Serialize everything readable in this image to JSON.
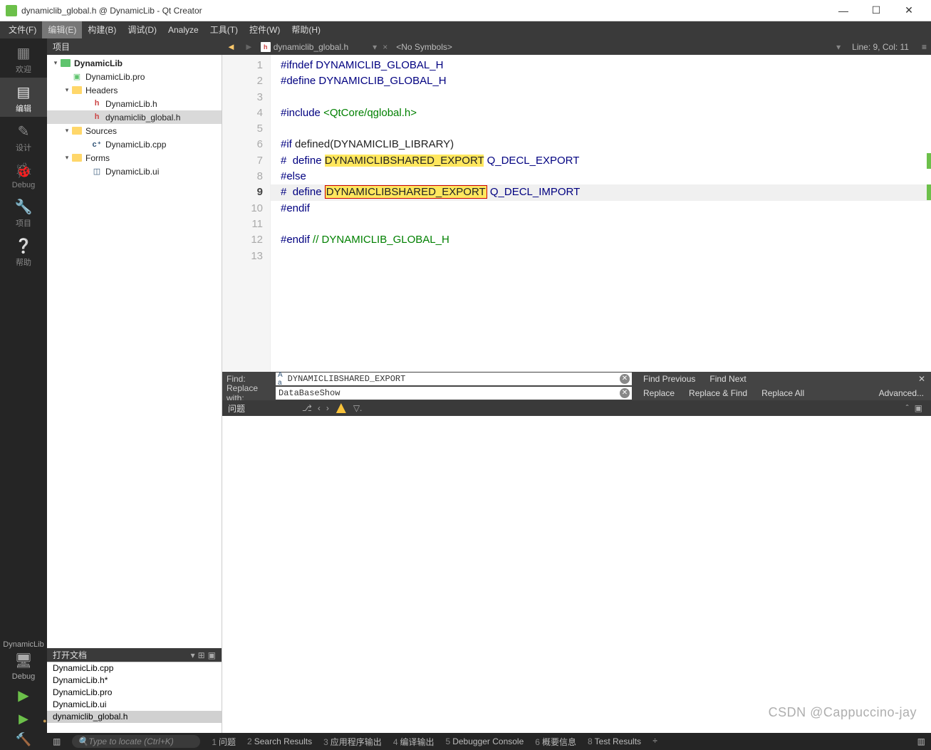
{
  "window": {
    "title": "dynamiclib_global.h @ DynamicLib - Qt Creator"
  },
  "menu": {
    "file": "文件(F)",
    "edit": "编辑(E)",
    "build": "构建(B)",
    "debug": "调试(D)",
    "analyze": "Analyze",
    "tools": "工具(T)",
    "widgets": "控件(W)",
    "help": "帮助(H)"
  },
  "modes": {
    "welcome": "欢迎",
    "edit": "编辑",
    "design": "设计",
    "debug": "Debug",
    "projects": "项目",
    "help": "帮助"
  },
  "kit": {
    "name": "DynamicLib",
    "config": "Debug"
  },
  "project_header": "项目",
  "tree": {
    "root": "DynamicLib",
    "pro": "DynamicLib.pro",
    "headers_label": "Headers",
    "headers": [
      "DynamicLib.h",
      "dynamiclib_global.h"
    ],
    "sources_label": "Sources",
    "sources": [
      "DynamicLib.cpp"
    ],
    "forms_label": "Forms",
    "forms": [
      "DynamicLib.ui"
    ]
  },
  "opendocs_header": "打开文档",
  "opendocs": [
    "DynamicLib.cpp",
    "DynamicLib.h*",
    "DynamicLib.pro",
    "DynamicLib.ui",
    "dynamiclib_global.h"
  ],
  "editor_tab": {
    "filename": "dynamiclib_global.h",
    "symbols": "<No Symbols>",
    "position": "Line: 9, Col: 11"
  },
  "code_lines": {
    "l1": {
      "pp": "#ifndef",
      "sp": " ",
      "mac": "DYNAMICLIB_GLOBAL_H"
    },
    "l2": {
      "pp": "#define",
      "sp": " ",
      "mac": "DYNAMICLIB_GLOBAL_H"
    },
    "l4": {
      "pp": "#include",
      "sp": " ",
      "str": "<QtCore/qglobal.h>"
    },
    "l6": {
      "pp": "#if",
      "sp": " ",
      "txt": "defined(DYNAMICLIB_LIBRARY)"
    },
    "l7": {
      "pp": "#",
      "sp": "  ",
      "kw": "define",
      "sp2": " ",
      "hl": "DYNAMICLIBSHARED_EXPORT",
      "sp3": " ",
      "mac": "Q_DECL_EXPORT"
    },
    "l8": {
      "pp": "#else"
    },
    "l9": {
      "pp": "#",
      "sp": "  ",
      "kw": "define",
      "sp2": " ",
      "hl": "DYNAMICLIBSHARED_EXPORT",
      "sp3": " ",
      "mac": "Q_DECL_IMPORT"
    },
    "l10": {
      "pp": "#endif"
    },
    "l12": {
      "pp": "#endif",
      "sp": " ",
      "com": "// DYNAMICLIB_GLOBAL_H"
    }
  },
  "find": {
    "find_label": "Find:",
    "find_value": "DYNAMICLIBSHARED_EXPORT",
    "replace_label": "Replace with:",
    "replace_value": "DataBaseShow",
    "find_prev": "Find Previous",
    "find_next": "Find Next",
    "replace": "Replace",
    "replace_find": "Replace & Find",
    "replace_all": "Replace All",
    "advanced": "Advanced..."
  },
  "issues": {
    "label": "问题"
  },
  "statusbar": {
    "locator_placeholder": "Type to locate (Ctrl+K)",
    "tabs": [
      {
        "n": "1",
        "t": "问题"
      },
      {
        "n": "2",
        "t": "Search Results"
      },
      {
        "n": "3",
        "t": "应用程序输出"
      },
      {
        "n": "4",
        "t": "编译输出"
      },
      {
        "n": "5",
        "t": "Debugger Console"
      },
      {
        "n": "6",
        "t": "概要信息"
      },
      {
        "n": "8",
        "t": "Test Results"
      }
    ]
  },
  "watermark": "CSDN @Cappuccino-jay"
}
